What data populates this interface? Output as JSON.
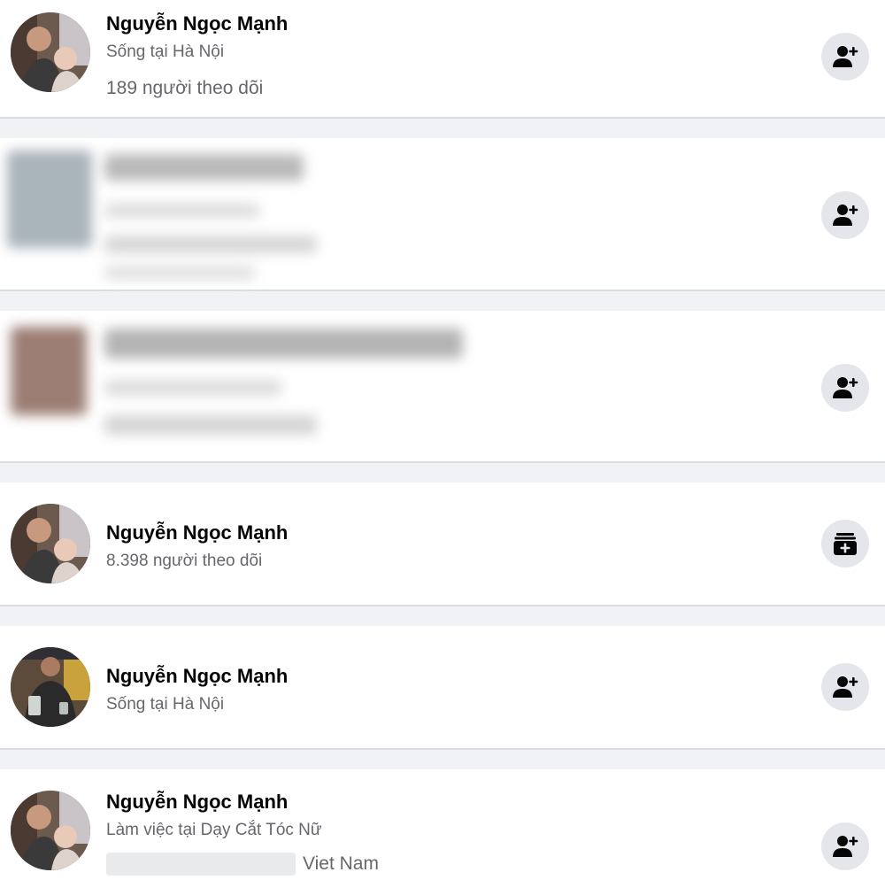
{
  "results": [
    {
      "name": "Nguyễn Ngọc Mạnh",
      "line1": "Sống tại Hà Nội",
      "line2": "189 người theo dõi",
      "action_icon": "add-friend-icon"
    },
    {
      "name": "",
      "action_icon": "add-friend-icon"
    },
    {
      "name": "",
      "action_icon": "add-friend-icon"
    },
    {
      "name": "Nguyễn Ngọc Mạnh",
      "line1": "8.398 người theo dõi",
      "action_icon": "add-page-icon"
    },
    {
      "name": "Nguyễn Ngọc Mạnh",
      "line1": "Sống tại Hà Nội",
      "action_icon": "add-friend-icon"
    },
    {
      "name": "Nguyễn Ngọc Mạnh",
      "line1": "Làm việc tại Dạy Cắt Tóc Nữ",
      "line2": "Viet Nam",
      "action_icon": "add-friend-icon"
    }
  ],
  "colors": {
    "background": "#f0f2f5",
    "card": "#ffffff",
    "button": "#e4e6eb",
    "secondary_text": "#65676b"
  }
}
